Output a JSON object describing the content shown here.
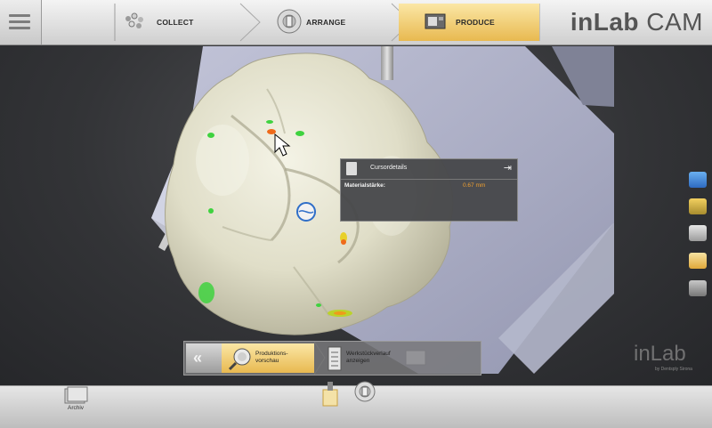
{
  "header": {
    "steps": [
      {
        "label": "COLLECT",
        "icon": "collect-icon"
      },
      {
        "label": "ARRANGE",
        "icon": "arrange-icon"
      },
      {
        "label": "PRODUCE",
        "icon": "produce-icon",
        "active": true
      }
    ],
    "app_title_bold": "inLab",
    "app_title_rest": " CAM"
  },
  "cursor_details": {
    "title": "Cursordetails",
    "label": "Materialstärke:",
    "value": "0.67 mm"
  },
  "actions": [
    {
      "label": "Produktions-\nvorschau",
      "icon": "production-preview-icon",
      "active": true
    },
    {
      "label": "Werkstückverlauf\nanzeigen",
      "icon": "workpiece-history-icon"
    }
  ],
  "bottom": {
    "archive_label": "Archiv"
  },
  "watermark": {
    "logo": "inLab",
    "sub": "by Dentsply Sirona"
  },
  "colors": {
    "accent": "#e8b950",
    "value": "#f0a030",
    "hotspot_green": "#3fd23f",
    "hotspot_orange": "#ef6a1a"
  }
}
